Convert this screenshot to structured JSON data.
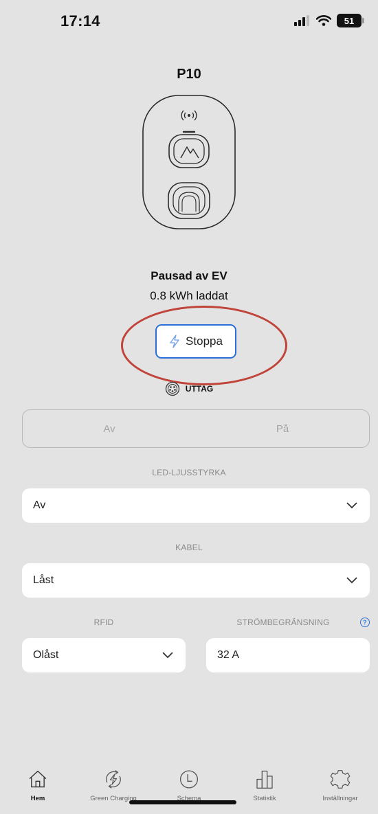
{
  "status_bar": {
    "time": "17:14",
    "battery": "51"
  },
  "device": {
    "name": "P10"
  },
  "charging": {
    "status": "Pausad av EV",
    "energy": "0.8 kWh laddat",
    "stop_label": "Stoppa",
    "outlet_label": "UTTAG"
  },
  "toggle": {
    "off_label": "Av",
    "on_label": "På"
  },
  "led": {
    "label": "LED-LJUSSTYRKA",
    "value": "Av"
  },
  "cable": {
    "label": "KABEL",
    "value": "Låst"
  },
  "rfid": {
    "label": "RFID",
    "value": "Olåst"
  },
  "current_limit": {
    "label": "STRÖMBEGRÄNSNING",
    "value": "32 A",
    "help_glyph": "?"
  },
  "colors": {
    "accent": "#2a6ed8",
    "annotation": "#c0443a",
    "background": "#e3e3e3"
  },
  "tabs": [
    {
      "label": "Hem",
      "icon": "home-icon",
      "active": true
    },
    {
      "label": "Green Charging",
      "icon": "green-charging-icon",
      "active": false
    },
    {
      "label": "Schema",
      "icon": "clock-icon",
      "active": false
    },
    {
      "label": "Statistik",
      "icon": "bar-chart-icon",
      "active": false
    },
    {
      "label": "Inställningar",
      "icon": "gear-icon",
      "active": false
    }
  ]
}
